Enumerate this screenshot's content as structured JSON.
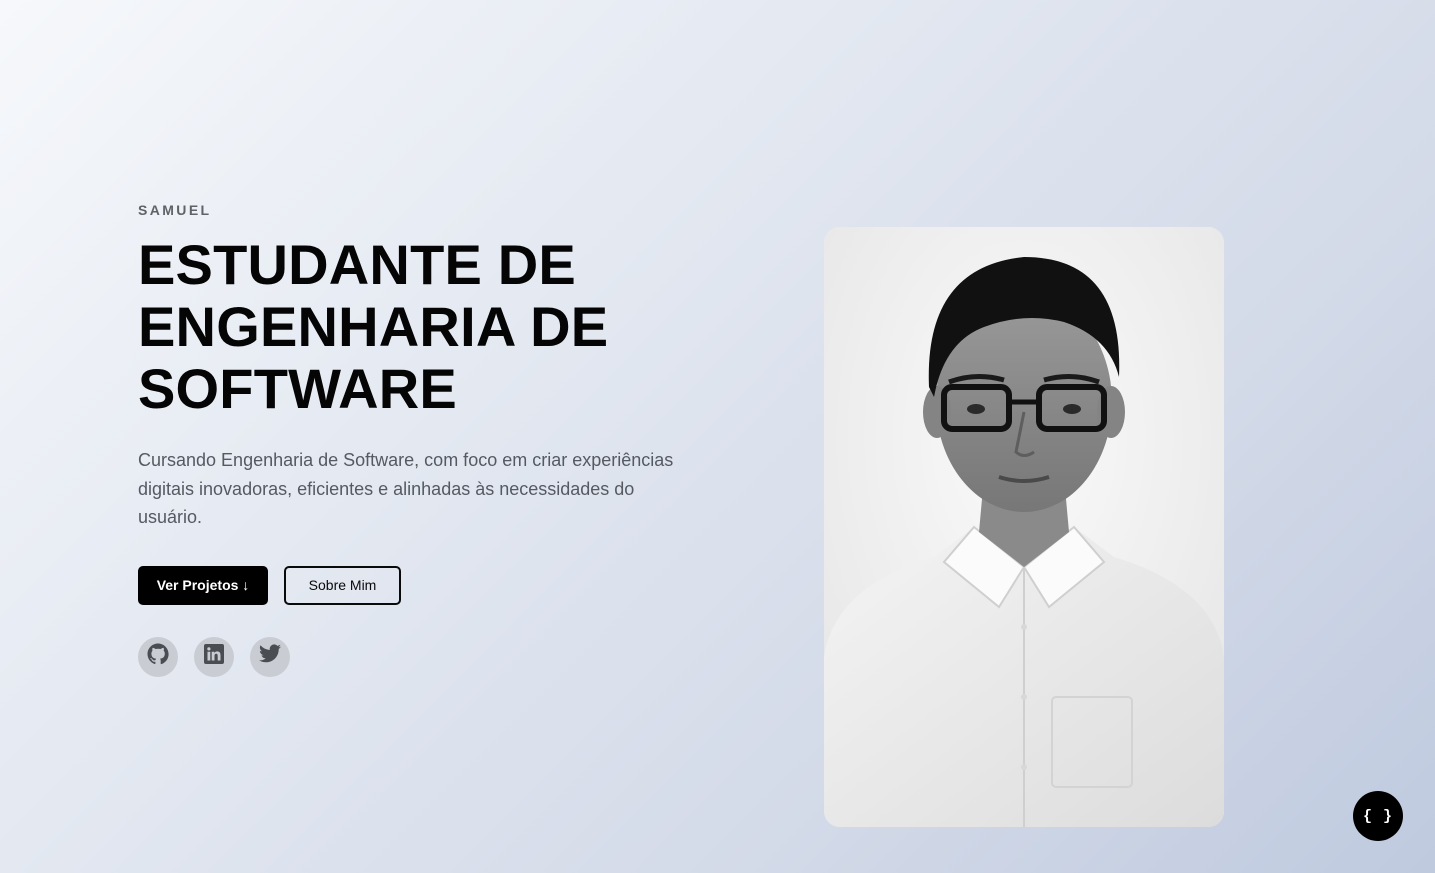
{
  "hero": {
    "kicker": "SAMUEL",
    "title_lines": [
      "ESTUDANTE DE",
      "ENGENHARIA DE",
      "SOFTWARE"
    ],
    "description": "Cursando Engenharia de Software, com foco em criar experiências digitais inovadoras, eficientes e alinhadas às necessidades do usuário.",
    "buttons": {
      "primary": "Ver Projetos ↓",
      "secondary": "Sobre Mim"
    },
    "socials": [
      {
        "icon": "github-icon"
      },
      {
        "icon": "linkedin-icon"
      },
      {
        "icon": "twitter-icon"
      }
    ]
  },
  "portrait": {
    "style": "black-and-white photo of man with glasses in white shirt"
  },
  "fab": {
    "label": "{ }"
  },
  "colors": {
    "primary": "#000000",
    "text": "#050505",
    "muted": "#555a62",
    "social_bg": "#c9ccd2"
  }
}
